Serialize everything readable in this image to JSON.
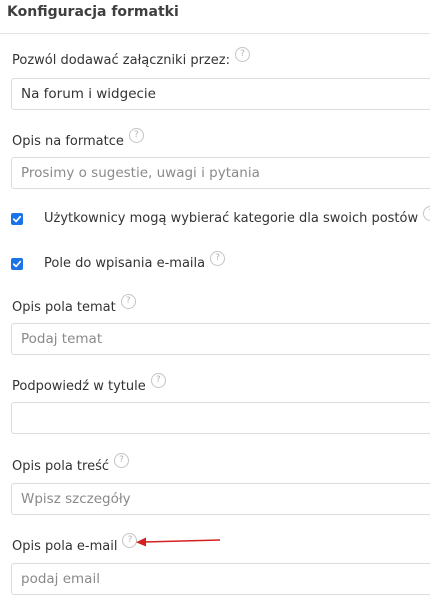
{
  "panel": {
    "title": "Konfiguracja formatki"
  },
  "fields": {
    "attachments": {
      "label": "Pozwól dodawać załączniki przez:",
      "value": "Na forum i widgecie"
    },
    "form_description": {
      "label": "Opis na formatce",
      "placeholder": "Prosimy o sugestie, uwagi i pytania"
    },
    "categories_checkbox": {
      "label": "Użytkownicy mogą wybierać kategorie dla swoich postów",
      "checked": true
    },
    "email_checkbox": {
      "label": "Pole do wpisania e-maila",
      "checked": true
    },
    "subject_field": {
      "label": "Opis pola temat",
      "placeholder": "Podaj temat"
    },
    "title_hint": {
      "label": "Podpowiedź w tytule",
      "placeholder": ""
    },
    "content_field": {
      "label": "Opis pola treść",
      "placeholder": "Wpisz szczegóły"
    },
    "email_field": {
      "label": "Opis pola e-mail",
      "placeholder": "podaj email"
    }
  },
  "help_icon": {
    "glyph": "?",
    "icon": "question-circle-icon"
  },
  "colors": {
    "checkbox": "#1a73e8",
    "annotation_arrow": "#d42020"
  }
}
